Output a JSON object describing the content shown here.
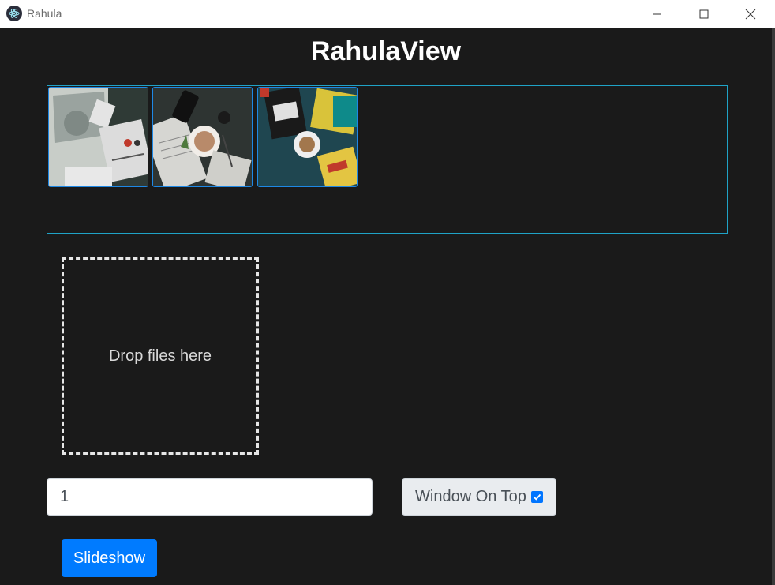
{
  "window": {
    "title": "Rahula",
    "icon": "electron-app-icon",
    "controls": [
      "minimize-icon",
      "maximize-icon",
      "close-icon"
    ]
  },
  "header": {
    "title": "RahulaView"
  },
  "gallery": {
    "border_color": "#1fa3c7",
    "thumbnails": [
      {
        "icon": "photo-thumbnail"
      },
      {
        "icon": "photo-thumbnail"
      },
      {
        "icon": "photo-thumbnail"
      }
    ]
  },
  "dropzone": {
    "label": "Drop files here"
  },
  "interval_input": {
    "value": "1"
  },
  "window_on_top": {
    "label": "Window On Top",
    "checked": true
  },
  "slideshow_button": {
    "label": "Slideshow",
    "color": "#007bff"
  },
  "colors": {
    "background": "#1a1a1a",
    "accent": "#007bff"
  }
}
